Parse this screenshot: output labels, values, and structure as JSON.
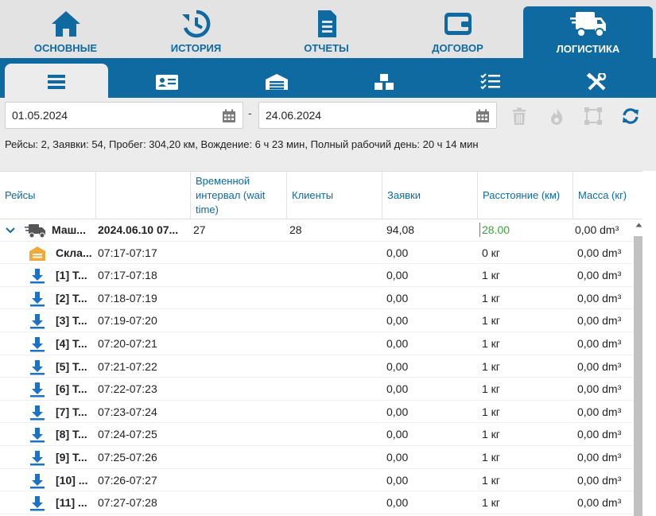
{
  "top_tabs": [
    {
      "label": "ОСНОВНЫЕ",
      "icon": "home-icon"
    },
    {
      "label": "ИСТОРИЯ",
      "icon": "history-icon"
    },
    {
      "label": "ОТЧЕТЫ",
      "icon": "report-icon"
    },
    {
      "label": "ДОГОВОР",
      "icon": "wallet-icon"
    },
    {
      "label": "ЛОГИСТИКА",
      "icon": "truck-icon",
      "active": true
    }
  ],
  "sub_tabs": [
    {
      "icon": "list-icon",
      "active": true
    },
    {
      "icon": "id-card-icon"
    },
    {
      "icon": "warehouse-icon"
    },
    {
      "icon": "boxes-icon"
    },
    {
      "icon": "checklist-icon"
    },
    {
      "icon": "tools-icon"
    }
  ],
  "filter": {
    "date_from": "01.05.2024",
    "date_to": "24.06.2024",
    "separator": "-",
    "summary": "Рейсы: 2, Заявки: 54, Пробег: 304,20 км, Вождение: 6 ч 23 мин, Полный рабочий день: 20 ч 14 мин"
  },
  "columns": [
    "Рейсы",
    "",
    "Временной интервал (wait time)",
    "Клиенты",
    "Заявки",
    "Расстояние (км)",
    "Масса (кг)"
  ],
  "trip_row": {
    "name": "Маш...",
    "date": "2024.06.10 07...",
    "interval": "27",
    "clients": "28",
    "orders": "94,08",
    "distance": "28.00",
    "mass": "0,00 dm³"
  },
  "rows": [
    {
      "name": "Скла...",
      "time": "07:17-07:17",
      "orders": "0,00",
      "distance": "0 кг",
      "mass": "0,00 dm³",
      "icon": "warehouse-icon"
    },
    {
      "name": "[1] T...",
      "time": "07:17-07:18",
      "orders": "0,00",
      "distance": "1 кг",
      "mass": "0,00 dm³",
      "icon": "download-icon"
    },
    {
      "name": "[2] T...",
      "time": "07:18-07:19",
      "orders": "0,00",
      "distance": "1 кг",
      "mass": "0,00 dm³",
      "icon": "download-icon"
    },
    {
      "name": "[3] T...",
      "time": "07:19-07:20",
      "orders": "0,00",
      "distance": "1 кг",
      "mass": "0,00 dm³",
      "icon": "download-icon"
    },
    {
      "name": "[4] T...",
      "time": "07:20-07:21",
      "orders": "0,00",
      "distance": "1 кг",
      "mass": "0,00 dm³",
      "icon": "download-icon"
    },
    {
      "name": "[5] T...",
      "time": "07:21-07:22",
      "orders": "0,00",
      "distance": "1 кг",
      "mass": "0,00 dm³",
      "icon": "download-icon"
    },
    {
      "name": "[6] T...",
      "time": "07:22-07:23",
      "orders": "0,00",
      "distance": "1 кг",
      "mass": "0,00 dm³",
      "icon": "download-icon"
    },
    {
      "name": "[7] T...",
      "time": "07:23-07:24",
      "orders": "0,00",
      "distance": "1 кг",
      "mass": "0,00 dm³",
      "icon": "download-icon"
    },
    {
      "name": "[8] T...",
      "time": "07:24-07:25",
      "orders": "0,00",
      "distance": "1 кг",
      "mass": "0,00 dm³",
      "icon": "download-icon"
    },
    {
      "name": "[9] T...",
      "time": "07:25-07:26",
      "orders": "0,00",
      "distance": "1 кг",
      "mass": "0,00 dm³",
      "icon": "download-icon"
    },
    {
      "name": "[10] ...",
      "time": "07:26-07:27",
      "orders": "0,00",
      "distance": "1 кг",
      "mass": "0,00 dm³",
      "icon": "download-icon"
    },
    {
      "name": "[11] ...",
      "time": "07:27-07:28",
      "orders": "0,00",
      "distance": "1 кг",
      "mass": "0,00 dm³",
      "icon": "download-icon"
    }
  ],
  "colors": {
    "brand_blue": "#0e6aa0",
    "tab_bg": "#e3e3e3",
    "distance_green": "#3aa63a",
    "row_icon_blue": "#1a73c7",
    "warehouse_orange": "#f2a93b"
  }
}
